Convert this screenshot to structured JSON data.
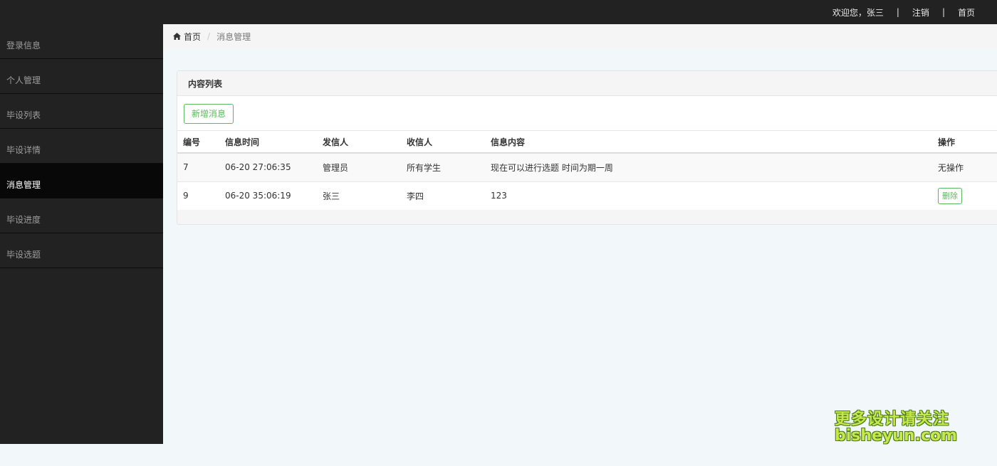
{
  "topbar": {
    "welcome": "欢迎您，张三",
    "separator": "|",
    "logout": "注销",
    "home": "首页"
  },
  "sidebar": {
    "items": [
      {
        "label": "登录信息"
      },
      {
        "label": "个人管理"
      },
      {
        "label": "毕设列表"
      },
      {
        "label": "毕设详情"
      },
      {
        "label": "消息管理"
      },
      {
        "label": "毕设进度"
      },
      {
        "label": "毕设选题"
      }
    ],
    "active_label": "消息管理"
  },
  "breadcrumb": {
    "home_icon": "home-icon",
    "home": "首页",
    "separator": "/",
    "current": "消息管理"
  },
  "panel": {
    "title": "内容列表",
    "add_button": "新增消息"
  },
  "table": {
    "headers": {
      "id": "编号",
      "time": "信息时间",
      "from": "发信人",
      "to": "收信人",
      "content": "信息内容",
      "op": "操作"
    },
    "rows": [
      {
        "id": "7",
        "time": "06-20 27:06:35",
        "from": "管理员",
        "to": "所有学生",
        "content": "现在可以进行选题 时间为期一周",
        "op": "无操作"
      },
      {
        "id": "9",
        "time": "06-20 35:06:19",
        "from": "张三",
        "to": "李四",
        "content": "123",
        "op": "删除"
      }
    ]
  },
  "watermark": {
    "line1": "更多设计请关注",
    "line2": "bisheyun.com"
  },
  "colors": {
    "dark_bar": "#222222",
    "accent_green": "#5cb85c",
    "page_bg": "#f2f7fa"
  }
}
